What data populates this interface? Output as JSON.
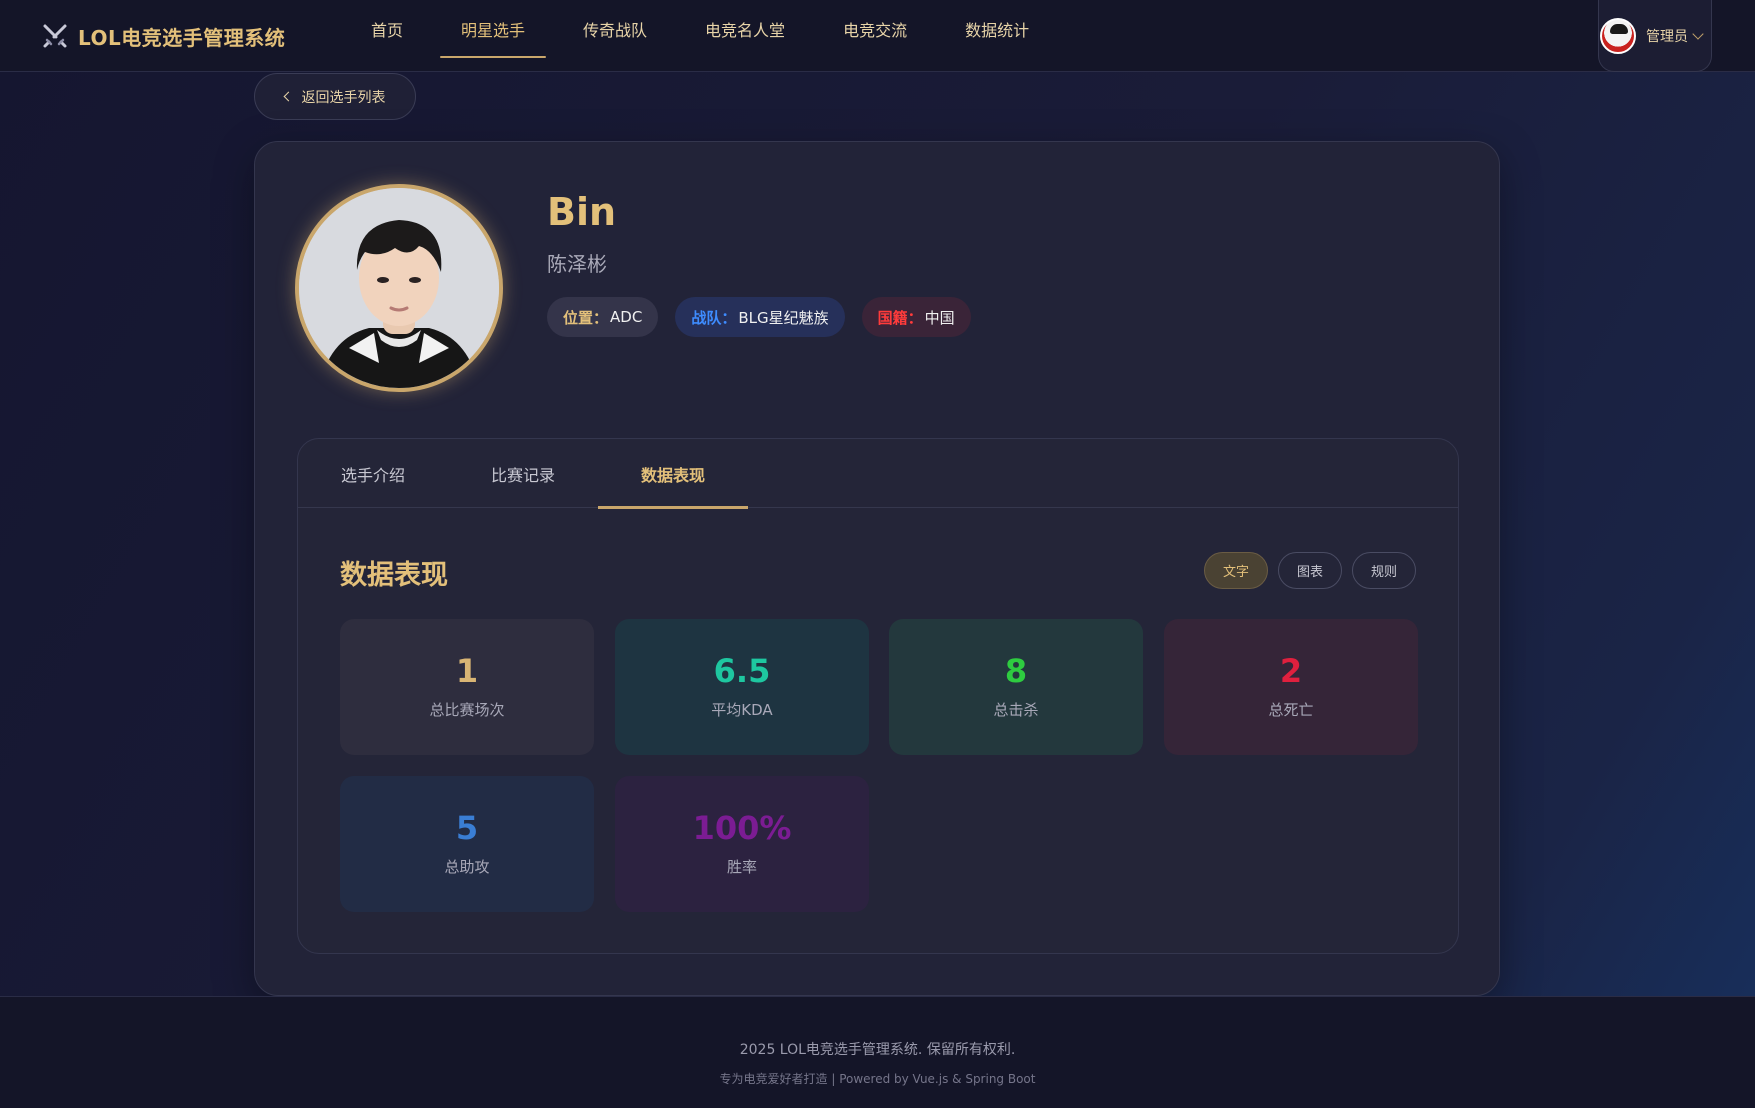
{
  "header": {
    "brand": "LOL电竞选手管理系统",
    "nav": [
      {
        "label": "首页",
        "active": false
      },
      {
        "label": "明星选手",
        "active": true
      },
      {
        "label": "传奇战队",
        "active": false
      },
      {
        "label": "电竞名人堂",
        "active": false
      },
      {
        "label": "电竞交流",
        "active": false
      },
      {
        "label": "数据统计",
        "active": false
      }
    ],
    "user": {
      "name": "管理员"
    }
  },
  "back_button": {
    "label": "返回选手列表"
  },
  "player": {
    "name": "Bin",
    "real_name": "陈泽彬",
    "tags": {
      "position": {
        "key": "位置：",
        "value": "ADC"
      },
      "team": {
        "key": "战队：",
        "value": "BLG星纪魅族"
      },
      "nationality": {
        "key": "国籍：",
        "value": "中国"
      }
    }
  },
  "tabs": [
    {
      "label": "选手介绍",
      "active": false
    },
    {
      "label": "比赛记录",
      "active": false
    },
    {
      "label": "数据表现",
      "active": true
    }
  ],
  "section": {
    "title": "数据表现",
    "view_switch": [
      {
        "label": "文字",
        "active": true
      },
      {
        "label": "图表",
        "active": false
      },
      {
        "label": "规则",
        "active": false
      }
    ]
  },
  "stats": [
    {
      "value": "1",
      "label": "总比赛场次",
      "color": "#d9b574"
    },
    {
      "value": "6.5",
      "label": "平均KDA",
      "color": "#1ec7a0"
    },
    {
      "value": "8",
      "label": "总击杀",
      "color": "#2ecc40"
    },
    {
      "value": "2",
      "label": "总死亡",
      "color": "#e0203e"
    },
    {
      "value": "5",
      "label": "总助攻",
      "color": "#3a7ed4"
    },
    {
      "value": "100%",
      "label": "胜率",
      "color": "#7b1c93"
    }
  ],
  "footer": {
    "copyright": "2025 LOL电竞选手管理系统. 保留所有权利.",
    "powered": "专为电竞爱好者打造 | Powered by Vue.js & Spring Boot"
  },
  "colors": {
    "accent": "#e3c07a",
    "team_key": "#3e8cff",
    "nationality_key": "#ff3b3b"
  }
}
